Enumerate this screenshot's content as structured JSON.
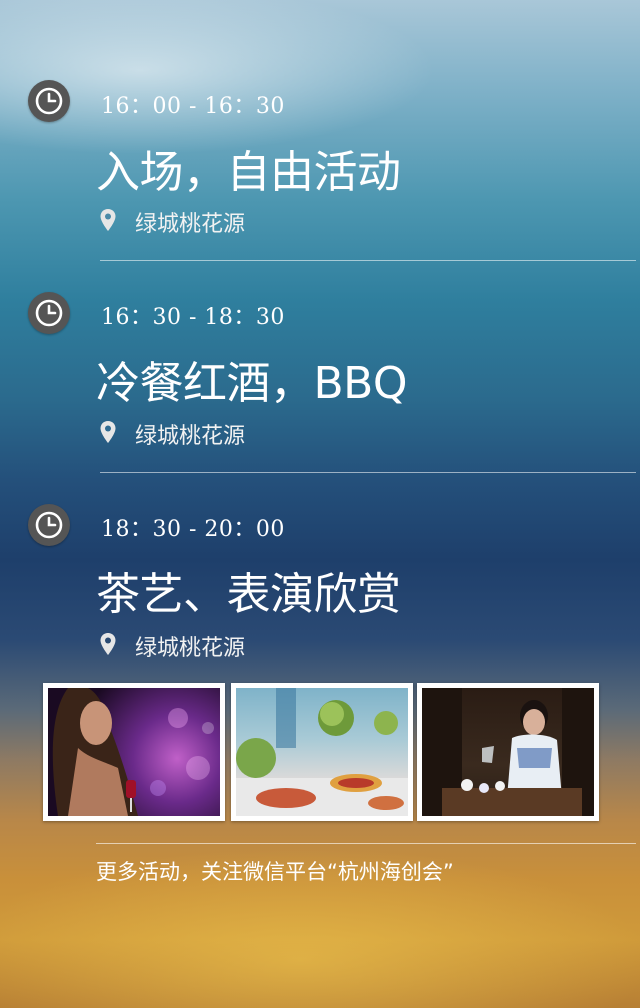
{
  "schedule": [
    {
      "time": "16：00 - 16：30",
      "title": "入场，自由活动",
      "location": "绿城桃花源"
    },
    {
      "time": "16：30 - 18：30",
      "title": "冷餐红酒，BBQ",
      "location": "绿城桃花源"
    },
    {
      "time": "18：30 - 20：00",
      "title": "茶艺、表演欣赏",
      "location": "绿城桃花源"
    }
  ],
  "photos": [
    "party-woman-photo",
    "buffet-table-photo",
    "tea-ceremony-photo"
  ],
  "footer": {
    "text": "更多活动，关注微信平台“杭州海创会”"
  },
  "colors": {
    "clock_bg": "#555555",
    "text": "#ffffff"
  }
}
